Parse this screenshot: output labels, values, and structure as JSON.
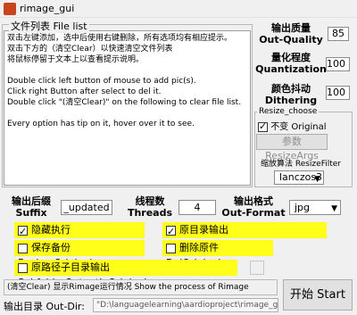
{
  "window": {
    "title": "rimage_gui"
  },
  "file_list": {
    "title": "文件列表 File list",
    "content": "双击左键添加，选中后使用右键删除，所有选项均有相应提示。\n双击下方的（清空Clear）以快速清空文件列表\n将鼠标停留于文本上以查看提示说明。\n\nDouble click left button of mouse to add pic(s).\nClick right Button after select to del it.\nDouble click \"(清空Clear)\" on the following to clear file list.\n\nEvery option has tip on it, hover over it to see."
  },
  "quality": {
    "label_cn": "输出质量",
    "label_en": "Out-Quality",
    "value": "85"
  },
  "quantization": {
    "label_cn": "量化程度",
    "label_en": "Quantization",
    "value": "100"
  },
  "dithering": {
    "label_cn": "颜色抖动",
    "label_en": "Dithering",
    "value": "100"
  },
  "resize": {
    "group_title": "Resize_choose",
    "keep_original_label": "不变 Original",
    "keep_original_checked": true,
    "args_button": "参数ResizeArgs",
    "filter_label": "缩放算法 ResizeFilter",
    "filter_value": "lanczos3"
  },
  "suffix": {
    "label_cn": "输出后缀",
    "label_en": "Suffix",
    "value": "_updated"
  },
  "threads": {
    "label_cn": "线程数",
    "label_en": "Threads",
    "value": "4"
  },
  "format": {
    "label_cn": "输出格式",
    "label_en": "Out-Format",
    "value": "jpg"
  },
  "options": {
    "hidden_execute": {
      "label": "隐藏执行 HiddenExecute",
      "checked": true
    },
    "output_in_original": {
      "label": "原目录输出 OutputInOriginalDir",
      "checked": true
    },
    "backup_original": {
      "label": "保存备份 BackupOriginal",
      "checked": false
    },
    "del_original": {
      "label": "删除原件 DelOriginal",
      "checked": false
    },
    "subfolder_output": {
      "label": "原路径子目录输出SubfolderOutputInOriginal",
      "checked": false
    }
  },
  "status_text": "(清空Clear) 显示Rimage运行情况 Show the process of Rimage",
  "start_button": "开始 Start",
  "output_dir": {
    "label": "输出目录 Out-Dir:",
    "value": "\"D:\\languagelearning\\aardioproject\\rimage_g"
  }
}
